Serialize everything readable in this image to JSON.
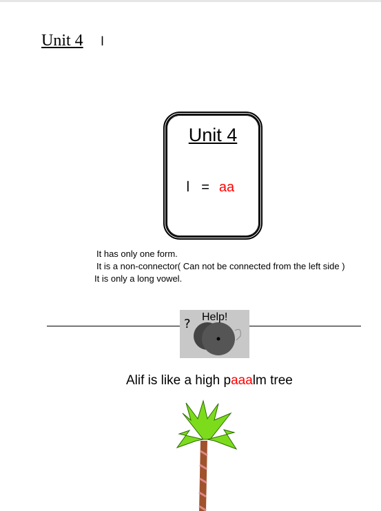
{
  "header": {
    "title": "Unit 4",
    "letter": "ا"
  },
  "card": {
    "title": "Unit 4",
    "letter": "ا",
    "equals": "=",
    "sound": "aa"
  },
  "notes": [
    "It has only one form.",
    "It is a non-connector( Can not be connected from the left side )",
    "It is only a long vowel."
  ],
  "help": {
    "label": "Help!"
  },
  "caption": {
    "before": "Alif is like a high p",
    "highlight": "aaa",
    "after": "lm tree"
  },
  "colors": {
    "highlight": "#ff0000"
  }
}
